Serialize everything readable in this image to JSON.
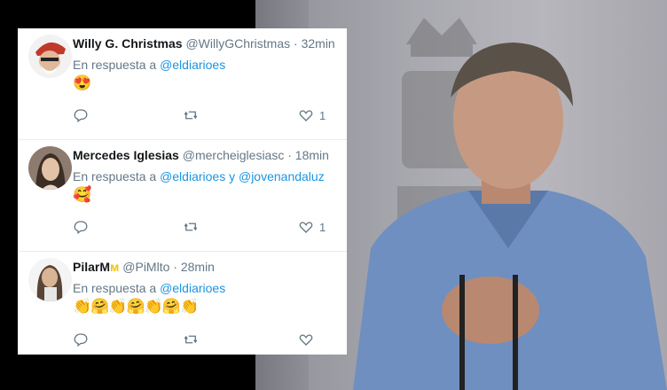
{
  "tweets": [
    {
      "name": "Willy G. Christmas",
      "handle": "@WillyGChristmas",
      "sep": "·",
      "time": "32min",
      "reply_prefix": "En respuesta a",
      "mention1": "@eldiarioes",
      "connector": "",
      "mention2": "",
      "emoji": "😍",
      "likes": "1",
      "avatar_color": "#c0392b"
    },
    {
      "name": "Mercedes Iglesias",
      "handle": "@mercheiglesiasc",
      "sep": "·",
      "time": "18min",
      "reply_prefix": "En respuesta a",
      "mention1": "@eldiarioes",
      "connector": "y",
      "mention2": "@jovenandaluz",
      "emoji": "🥰",
      "likes": "1",
      "avatar_color": "#5a4a3f"
    },
    {
      "name": "PilarM",
      "name_badge": "ᴍ",
      "handle": "@PiMlto",
      "sep": "·",
      "time": "28min",
      "reply_prefix": "En respuesta a",
      "mention1": "@eldiarioes",
      "connector": "",
      "mention2": "",
      "emoji": "👏🤗👏🤗👏🤗👏",
      "likes": "",
      "avatar_color": "#6b5b4d"
    }
  ],
  "icons": [
    "reply-icon",
    "retweet-icon",
    "like-icon"
  ],
  "colors": {
    "link": "#1b95e0",
    "muted": "#657786",
    "text": "#14171a"
  }
}
